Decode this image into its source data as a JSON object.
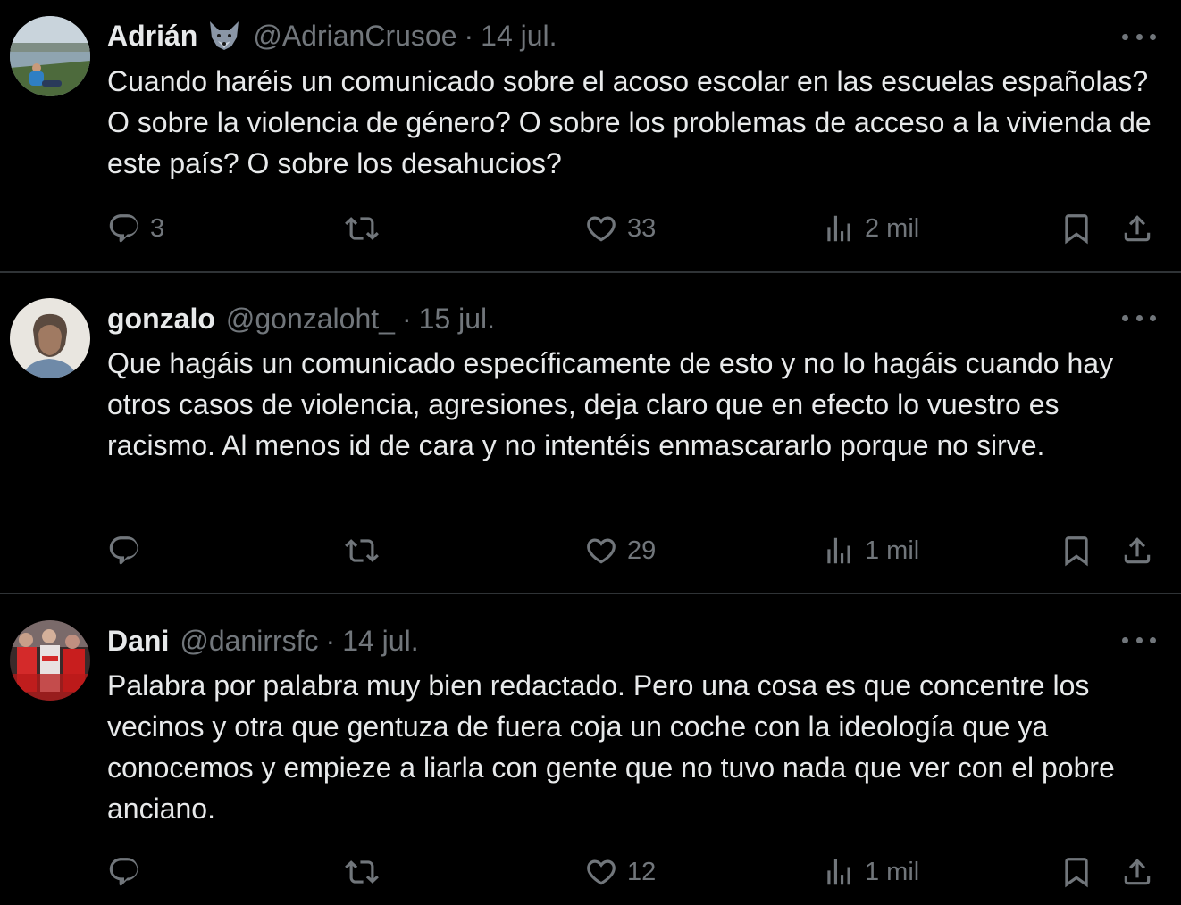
{
  "tweets": [
    {
      "name": "Adrián",
      "emoji": "wolf-emoji",
      "handle": "@AdrianCrusoe",
      "separator": "·",
      "date": "14 jul.",
      "text": "Cuando haréis un comunicado sobre el acoso escolar en las escuelas españolas? O sobre la violencia de género? O sobre los problemas de acceso a la vivienda de este país? O sobre los desahucios?",
      "replies": "3",
      "retweets": "",
      "likes": "33",
      "views": "2 mil"
    },
    {
      "name": "gonzalo",
      "handle": "@gonzaloht_",
      "separator": "·",
      "date": "15 jul.",
      "text": "Que hagáis un comunicado específicamente de esto y no lo hagáis cuando hay otros casos de violencia, agresiones, deja claro que en efecto lo vuestro es racismo. Al menos id de cara y no intentéis enmascararlo porque no sirve.",
      "replies": "",
      "retweets": "",
      "likes": "29",
      "views": "1 mil"
    },
    {
      "name": "Dani",
      "handle": "@danirrsfc",
      "separator": "·",
      "date": "14 jul.",
      "text": "Palabra por palabra muy bien redactado. Pero una cosa es que concentre los vecinos y otra que gentuza de fuera coja un coche con la ideología que ya conocemos  y empieze a liarla con gente que no tuvo nada que ver con el pobre anciano.",
      "replies": "",
      "retweets": "",
      "likes": "12",
      "views": "1 mil"
    }
  ],
  "icons": {
    "reply": "reply-icon",
    "retweet": "retweet-icon",
    "like": "heart-icon",
    "views": "views-icon",
    "bookmark": "bookmark-icon",
    "share": "share-icon",
    "more": "more-icon"
  },
  "colors": {
    "background": "#000000",
    "text": "#e7e9ea",
    "secondary": "#71767b",
    "divider": "#2f3336"
  }
}
